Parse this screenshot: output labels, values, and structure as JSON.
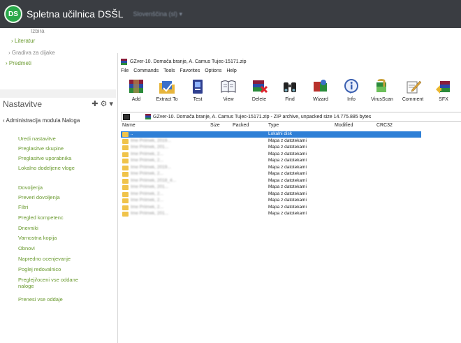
{
  "topbar": {
    "logo_text": "DS",
    "site_title": "Spletna učilnica DSŠL",
    "language_menu": "Slovenščina (sl) ▾"
  },
  "course_tree": [
    {
      "label": "Izbira",
      "style": "muted"
    },
    {
      "label": "› Literatur",
      "style": "green"
    },
    {
      "label": "› Gradiva za dijake",
      "style": "muted"
    },
    {
      "label": "› Predmeti",
      "style": "green"
    }
  ],
  "settings": {
    "title": "Nastavitve",
    "icons": "✚ ⚙ ▾",
    "admin_line": "‹ Administracija modula Naloga",
    "links": [
      "Uredi nastavitve",
      "Preglasitve skupine",
      "Preglasitve uporabnika",
      "Lokalno dodeljene vloge",
      "Dovoljenja",
      "Preveri dovoljenja",
      "Filtri",
      "Pregled kompetenc",
      "Dnevniki",
      "Varnostna kopija",
      "Obnovi",
      "Napredno ocenjevanje",
      "Poglej redovalnico",
      "Pregleji/oceni vse oddane naloge",
      "Prenesi vse oddaje"
    ]
  },
  "winrar": {
    "title": "GZver-10. Domača branje, A. Camus Tujec-15171.zip",
    "menu": [
      "File",
      "Commands",
      "Tools",
      "Favorites",
      "Options",
      "Help"
    ],
    "toolbar": [
      {
        "label": "Add",
        "icon": "add-archive-icon"
      },
      {
        "label": "Extract To",
        "icon": "extract-to-icon"
      },
      {
        "label": "Test",
        "icon": "test-icon"
      },
      {
        "label": "View",
        "icon": "view-icon"
      },
      {
        "label": "Delete",
        "icon": "delete-icon"
      },
      {
        "label": "Find",
        "icon": "find-icon"
      },
      {
        "label": "Wizard",
        "icon": "wizard-icon"
      },
      {
        "label": "Info",
        "icon": "info-icon"
      },
      {
        "label": "VirusScan",
        "icon": "virus-scan-icon"
      },
      {
        "label": "Comment",
        "icon": "comment-icon"
      },
      {
        "label": "SFX",
        "icon": "sfx-icon"
      }
    ],
    "path": "GZver-10. Domača branje, A. Camus Tujec-15171.zip - ZIP archive, unpacked size 14.775.885 bytes",
    "columns": [
      "Name",
      "Size",
      "Packed",
      "Type",
      "Modified",
      "CRC32"
    ],
    "rows": [
      {
        "name": "..",
        "type": "Lokalni disk",
        "selected": true
      },
      {
        "name": "Ime Priimek, 2019...",
        "type": "Mapa z datotekami"
      },
      {
        "name": "Ime Priimek, 201...",
        "type": "Mapa z datotekami"
      },
      {
        "name": "Ime Priimek, 2...",
        "type": "Mapa z datotekami"
      },
      {
        "name": "Ime Priimek, 2...",
        "type": "Mapa z datotekami"
      },
      {
        "name": "Ime Priimek, 2019...",
        "type": "Mapa z datotekami"
      },
      {
        "name": "Ime Priimek, 2...",
        "type": "Mapa z datotekami"
      },
      {
        "name": "Ime Priimek, 2018_4...",
        "type": "Mapa z datotekami"
      },
      {
        "name": "Ime Priimek, 201...",
        "type": "Mapa z datotekami"
      },
      {
        "name": "Ime Priimek, 2...",
        "type": "Mapa z datotekami"
      },
      {
        "name": "Ime Priimek, 2...",
        "type": "Mapa z datotekami"
      },
      {
        "name": "Ime Priimek, 2...",
        "type": "Mapa z datotekami"
      },
      {
        "name": "Ime Priimek, 201...",
        "type": "Mapa z datotekami"
      }
    ]
  }
}
